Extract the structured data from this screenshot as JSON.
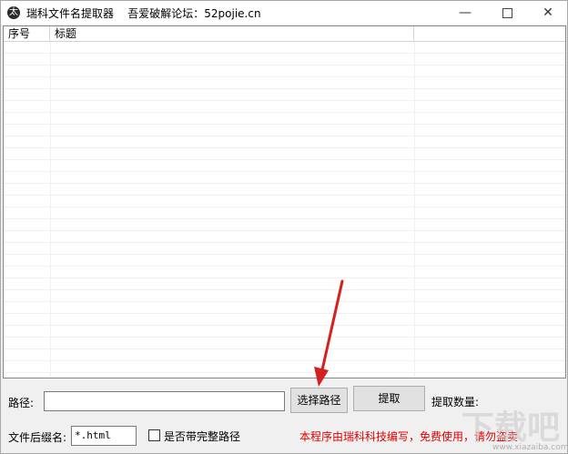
{
  "window": {
    "title": "瑞科文件名提取器    吾爱破解论坛：52pojie.cn",
    "app_icon_glyph": "太",
    "minimize_glyph": "—",
    "close_glyph": "✕"
  },
  "list": {
    "columns": [
      "序号",
      "标题"
    ]
  },
  "controls": {
    "path_label": "路径:",
    "path_value": "",
    "select_path_button": "选择路径",
    "extract_button": "提取",
    "extract_count_label": "提取数量:",
    "suffix_label": "文件后缀名:",
    "suffix_value": "*.html",
    "full_path_checkbox_label": "是否带完整路径",
    "full_path_checked": false,
    "notice": "本程序由瑞科科技编写，免费使用，请勿盗卖"
  },
  "colors": {
    "notice": "#e00000",
    "arrow": "#d42020"
  },
  "watermark": {
    "logo_text": "下载吧",
    "site": "www.xiazaiba.com"
  }
}
